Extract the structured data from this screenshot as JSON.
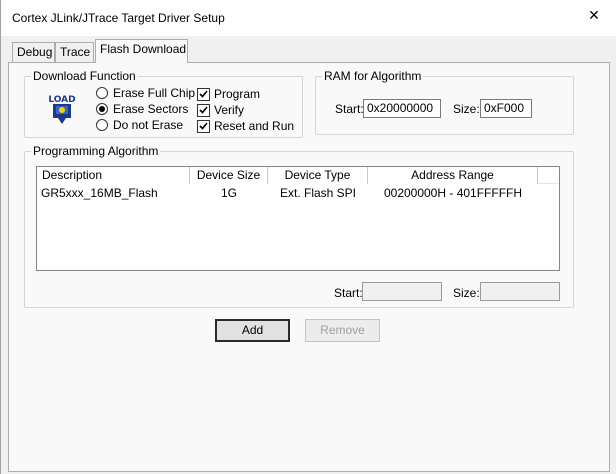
{
  "window": {
    "title": "Cortex JLink/JTrace Target Driver Setup",
    "close_glyph": "✕"
  },
  "tabs": [
    {
      "label": "Debug",
      "active": false
    },
    {
      "label": "Trace",
      "active": false
    },
    {
      "label": "Flash Download",
      "active": true
    }
  ],
  "download_function": {
    "legend": "Download Function",
    "icon_text": "LOAD",
    "radios": [
      {
        "label": "Erase Full Chip",
        "checked": false
      },
      {
        "label": "Erase Sectors",
        "checked": true
      },
      {
        "label": "Do not Erase",
        "checked": false
      }
    ],
    "checkboxes": [
      {
        "label": "Program",
        "checked": true
      },
      {
        "label": "Verify",
        "checked": true
      },
      {
        "label": "Reset and Run",
        "checked": true
      }
    ]
  },
  "ram_for_algorithm": {
    "legend": "RAM for Algorithm",
    "start_label": "Start:",
    "start_value": "0x20000000",
    "size_label": "Size:",
    "size_value": "0xF000"
  },
  "programming_algorithm": {
    "legend": "Programming Algorithm",
    "columns": [
      "Description",
      "Device Size",
      "Device Type",
      "Address Range"
    ],
    "rows": [
      [
        "GR5xxx_16MB_Flash",
        "1G",
        "Ext. Flash SPI",
        "00200000H - 401FFFFFH"
      ]
    ],
    "start_label": "Start:",
    "start_value": "",
    "size_label": "Size:",
    "size_value": ""
  },
  "buttons": {
    "add": "Add",
    "remove": "Remove"
  },
  "colors": {
    "icon_blue": "#1a3a8a",
    "icon_yellow": "#f2d600"
  }
}
